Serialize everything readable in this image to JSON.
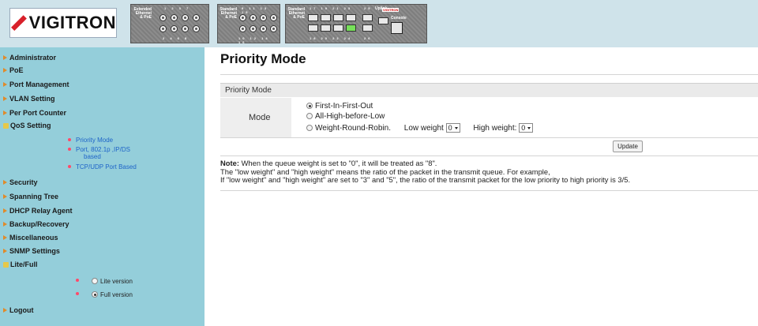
{
  "brand": {
    "logo_text": "VIGITRON",
    "accent": "#d8202a",
    "sidebar_bg": "#94ceda",
    "header_bg": "#cfe3ea"
  },
  "device_panel": {
    "group1": {
      "label": "Extended Ethernet & PoE",
      "top_nums": "1 2 3 7",
      "bottom_nums": "2 4 6 8"
    },
    "group2": {
      "label": "Standard Ethernet & PoE",
      "top_nums": "9 11 13 15",
      "bottom_nums": "10 12 14 16"
    },
    "group3": {
      "label": "Standard Ethernet & PoE",
      "top_nums": "17 19 21 23",
      "bottom_nums": "18 20 22 24",
      "uplink_label": "Uplink",
      "uplink_top": "25",
      "uplink_bottom": "26",
      "console_label": "Console",
      "mini_logo": "VIGITRON"
    }
  },
  "sidebar": {
    "items": [
      {
        "label": "Administrator",
        "icon": "arrow-right-icon"
      },
      {
        "label": "PoE",
        "icon": "arrow-right-icon"
      },
      {
        "label": "Port Management",
        "icon": "arrow-right-icon"
      },
      {
        "label": "VLAN Setting",
        "icon": "arrow-right-icon"
      },
      {
        "label": "Per Port Counter",
        "icon": "arrow-right-icon"
      },
      {
        "label": "QoS Setting",
        "icon": "folder-open-icon"
      },
      {
        "label": "Security",
        "icon": "arrow-right-icon"
      },
      {
        "label": "Spanning Tree",
        "icon": "arrow-right-icon"
      },
      {
        "label": "DHCP Relay Agent",
        "icon": "arrow-right-icon"
      },
      {
        "label": "Backup/Recovery",
        "icon": "arrow-right-icon"
      },
      {
        "label": "Miscellaneous",
        "icon": "arrow-right-icon"
      },
      {
        "label": "SNMP Settings",
        "icon": "arrow-right-icon"
      },
      {
        "label": "Lite/Full",
        "icon": "folder-open-icon"
      },
      {
        "label": "Logout",
        "icon": "arrow-right-icon"
      }
    ],
    "qos_sub": [
      {
        "label": "Priority Mode"
      },
      {
        "label": "Port, 802.1p ,IP/DS"
      },
      {
        "label": "based"
      },
      {
        "label": "TCP/UDP Port Based"
      }
    ],
    "version": {
      "lite": {
        "label": "Lite version",
        "checked": false
      },
      "full": {
        "label": "Full version",
        "checked": true
      }
    }
  },
  "main": {
    "title": "Priority Mode",
    "section_header": "Priority Mode",
    "mode_label": "Mode",
    "options": {
      "fifo": {
        "label": "First-In-First-Out",
        "checked": true
      },
      "high": {
        "label": "All-High-before-Low",
        "checked": false
      },
      "wrr": {
        "label": "Weight-Round-Robin.",
        "checked": false
      }
    },
    "low_weight": {
      "label": "Low weight",
      "value": "0"
    },
    "high_weight": {
      "label": "High weight:",
      "value": "0"
    },
    "update_label": "Update",
    "note": {
      "prefix": "Note:",
      "line1": " When the queue weight is set to \"0\", it will be treated as \"8\".",
      "line2": "The \"low weight\" and \"high weight\" means the ratio of the packet in the transmit queue. For example,",
      "line3": "If \"low weight\" and \"high weight\" are set to \"3\" and \"5\", the ratio of the transmit packet for the low priority to high priority is 3/5."
    }
  }
}
